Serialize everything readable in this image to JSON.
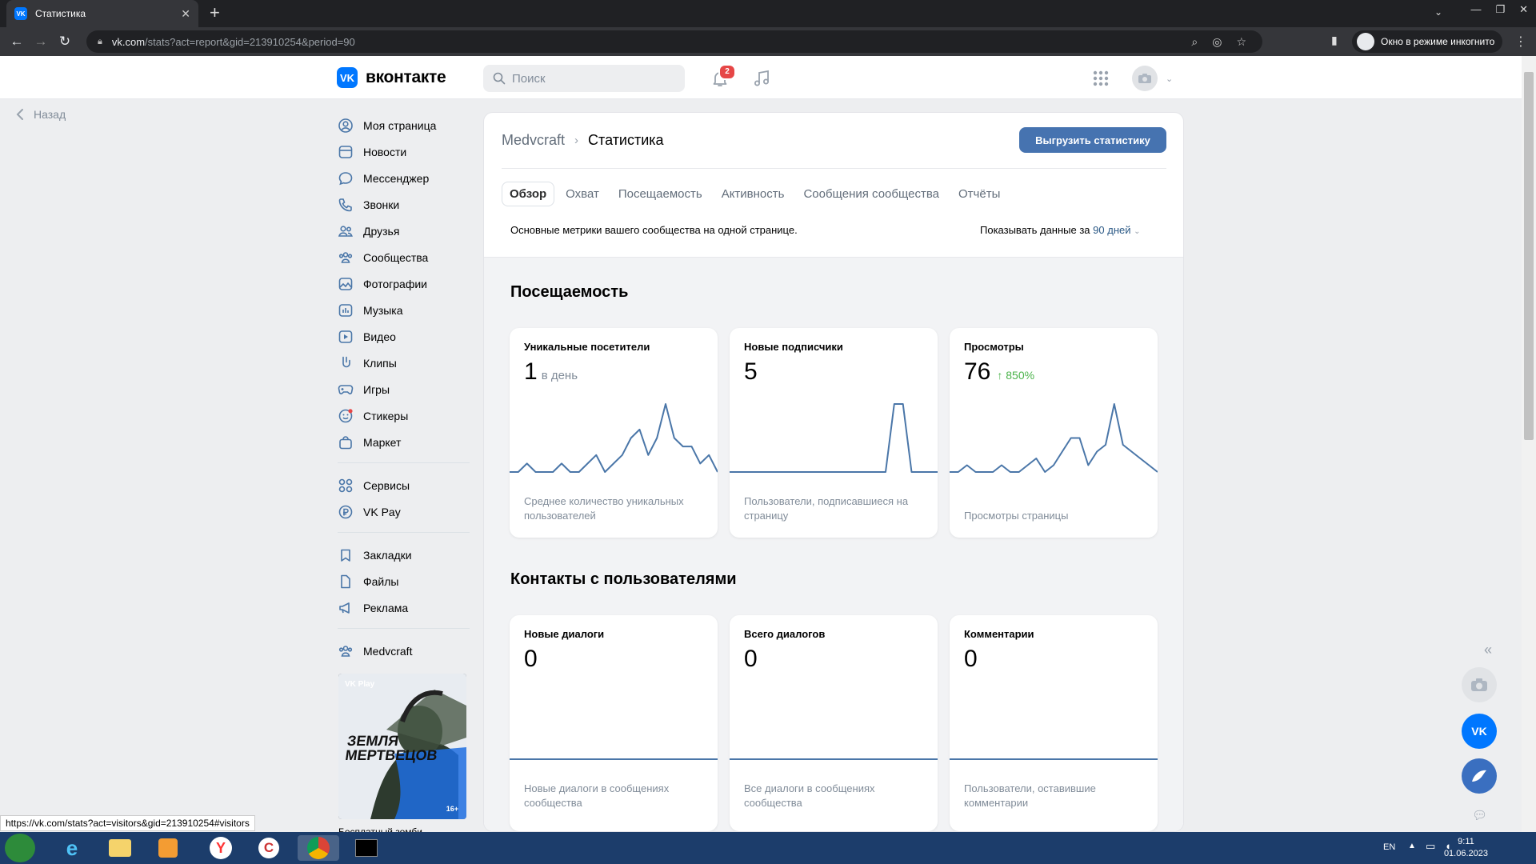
{
  "browser": {
    "tab_title": "Статистика",
    "tab_favicon": "VK",
    "url_host": "vk.com",
    "url_path": "/stats?act=report&gid=213910254&period=90",
    "incognito_label": "Окно в режиме инкогнито"
  },
  "header": {
    "logo_text": "вконтакте",
    "search_placeholder": "Поиск",
    "notification_count": "2"
  },
  "back_label": "Назад",
  "menu": {
    "group1": [
      "Моя страница",
      "Новости",
      "Мессенджер",
      "Звонки",
      "Друзья",
      "Сообщества",
      "Фотографии",
      "Музыка",
      "Видео",
      "Клипы",
      "Игры",
      "Стикеры",
      "Маркет"
    ],
    "group2": [
      "Сервисы",
      "VK Pay"
    ],
    "group3": [
      "Закладки",
      "Файлы",
      "Реклама"
    ],
    "group4": [
      "Medvcraft"
    ]
  },
  "ad": {
    "brand": "VK Play",
    "title": "ЗЕМЛЯ МЕРТВЕЦОВ",
    "age": "16+",
    "caption": "Бесплатный зомби..."
  },
  "stats": {
    "breadcrumb_community": "Medvcraft",
    "breadcrumb_page": "Статистика",
    "export_button": "Выгрузить статистику",
    "tabs": [
      "Обзор",
      "Охват",
      "Посещаемость",
      "Активность",
      "Сообщения сообщества",
      "Отчёты"
    ],
    "description": "Основные метрики вашего сообщества на одной странице.",
    "period_prefix": "Показывать данные за",
    "period_value": "90 дней",
    "sections": [
      {
        "title": "Посещаемость",
        "cards": [
          {
            "title": "Уникальные посетители",
            "value": "1",
            "unit": "в день",
            "change": "",
            "desc": "Среднее количество уникальных пользователей"
          },
          {
            "title": "Новые подписчики",
            "value": "5",
            "unit": "",
            "change": "",
            "desc": "Пользователи, подписавшиеся на страницу"
          },
          {
            "title": "Просмотры",
            "value": "76",
            "unit": "",
            "change": "850%",
            "desc": "Просмотры страницы"
          }
        ]
      },
      {
        "title": "Контакты с пользователями",
        "cards": [
          {
            "title": "Новые диалоги",
            "value": "0",
            "unit": "",
            "change": "",
            "desc": "Новые диалоги в сообщениях сообщества"
          },
          {
            "title": "Всего диалогов",
            "value": "0",
            "unit": "",
            "change": "",
            "desc": "Все диалоги в сообщениях сообщества"
          },
          {
            "title": "Комментарии",
            "value": "0",
            "unit": "",
            "change": "",
            "desc": "Пользователи, оставившие комментарии"
          }
        ]
      }
    ]
  },
  "sparklines": {
    "visitors": [
      0,
      0,
      1,
      0,
      0,
      0,
      1,
      0,
      0,
      1,
      2,
      0,
      1,
      2,
      4,
      5,
      2,
      4,
      8,
      4,
      3,
      3,
      1,
      2,
      0
    ],
    "subscribers": [
      0,
      0,
      0,
      0,
      0,
      0,
      0,
      0,
      0,
      0,
      0,
      0,
      0,
      0,
      0,
      0,
      0,
      0,
      0,
      5,
      5,
      0,
      0,
      0,
      0
    ],
    "views": [
      0,
      0,
      1,
      0,
      0,
      0,
      1,
      0,
      0,
      1,
      2,
      0,
      1,
      3,
      5,
      5,
      1,
      3,
      4,
      10,
      4,
      3,
      2,
      1,
      0
    ],
    "dialogs_new": [
      0,
      0,
      0,
      0,
      0
    ],
    "dialogs_total": [
      0,
      0,
      0,
      0,
      0
    ],
    "comments": [
      0,
      0,
      0,
      0,
      0
    ]
  },
  "status_url": "https://vk.com/stats?act=visitors&gid=213910254#visitors",
  "taskbar": {
    "lang": "EN",
    "time": "9:11",
    "date": "01.06.2023"
  },
  "colors": {
    "accent": "#0077ff",
    "button": "#4673b0",
    "line": "#4a76a8",
    "positive": "#4bb34b"
  }
}
